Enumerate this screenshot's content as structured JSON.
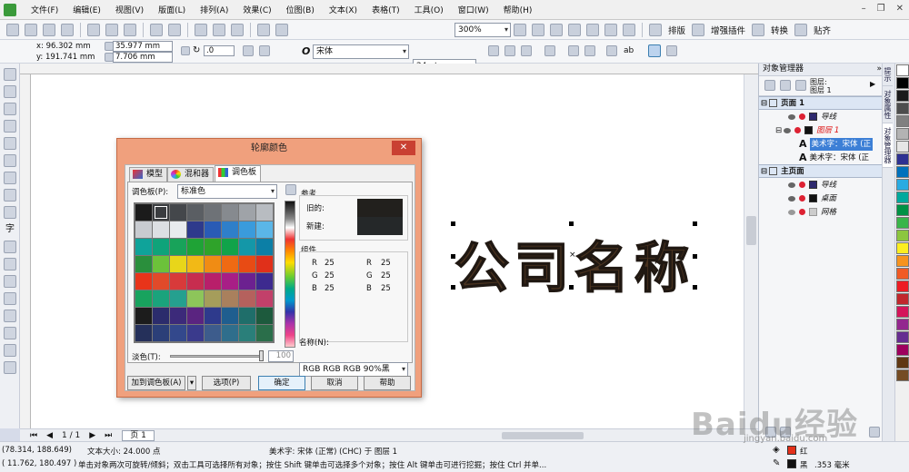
{
  "menubar": {
    "items": [
      "文件(F)",
      "编辑(E)",
      "视图(V)",
      "版面(L)",
      "排列(A)",
      "效果(C)",
      "位图(B)",
      "文本(X)",
      "表格(T)",
      "工具(O)",
      "窗口(W)",
      "帮助(H)"
    ]
  },
  "toolbar1": {
    "zoom": "300%",
    "layout_label": "排版",
    "plugin_label": "增强插件",
    "convert_label": "转换",
    "paste_label": "贴齐"
  },
  "toolbar2": {
    "x": "x: 96.302 mm",
    "y": "y: 191.741 mm",
    "w": "35.977 mm",
    "h": "7.706 mm",
    "rotation": ".0",
    "font": "宋体",
    "font_size": "24 pt",
    "ab_label": "ab"
  },
  "canvas": {
    "text": "公司名称"
  },
  "dialog": {
    "title": "轮廓颜色",
    "close": "✕",
    "tabs": [
      "模型",
      "混和器",
      "调色板"
    ],
    "palette_label": "调色板(P):",
    "palette_value": "标准色",
    "reference_label": "参考",
    "old_label": "旧的:",
    "new_label": "新建:",
    "old_color": "#22201d",
    "new_color": "#252829",
    "components_label": "组件",
    "r_label": "R",
    "g_label": "G",
    "b_label": "B",
    "r1": "25",
    "g1": "25",
    "b1": "25",
    "r2": "25",
    "g2": "25",
    "b2": "25",
    "name_label": "名称(N):",
    "name_value": "RGB RGB RGB 90%黑",
    "tint_label": "淡色(T):",
    "tint_value": "100",
    "add_palette_btn": "加到调色板(A)",
    "options_btn": "选项(P)",
    "ok_btn": "确定",
    "cancel_btn": "取消",
    "help_btn": "帮助",
    "swatches": [
      "#1b1b1b",
      "#3a3c3f",
      "#44474b",
      "#5a5e63",
      "#6e7277",
      "#868a8f",
      "#9fa3a8",
      "#b8bcc1",
      "#c8cbd0",
      "#dcdfe3",
      "#e9ebee",
      "#2e3a8c",
      "#2a5bb5",
      "#2f7fc9",
      "#3a9bdc",
      "#5ab6e8",
      "#0fa39a",
      "#0fa37a",
      "#18a35a",
      "#1fa336",
      "#2fa32a",
      "#11a34a",
      "#1497a8",
      "#0c7fa6",
      "#2a8f3c",
      "#6cc23a",
      "#e8d61a",
      "#f2b916",
      "#f08c14",
      "#ef6a14",
      "#e84b14",
      "#e0301a",
      "#e8341a",
      "#e14a2a",
      "#d83a3a",
      "#c72d4f",
      "#b81f6a",
      "#a81e86",
      "#6c2190",
      "#3d2a8f",
      "#18a35e",
      "#1aa37c",
      "#25a08f",
      "#8dc55a",
      "#a59d5b",
      "#a9805d",
      "#b5615d",
      "#c2406a",
      "#1c1c1c",
      "#2b2c6c",
      "#3c2a7a",
      "#5a2480",
      "#2e3a8c",
      "#1f5e8f",
      "#1f6e6a",
      "#1d5a3d",
      "#25305a",
      "#2b3f78",
      "#33488c",
      "#3a3a8c",
      "#3d5c8c",
      "#2f6e8c",
      "#2a7f7a",
      "#2a6e4a"
    ]
  },
  "docker": {
    "title": "对象管理器",
    "layer_header": "图层:",
    "layer_value": "图层 1",
    "page1": "页面 1",
    "guides": "导线",
    "layer1": "图层 1",
    "art1": "美术字：宋体 (正",
    "art2": "美术字：宋体 (正",
    "master": "主页面",
    "guides2": "导线",
    "desktop": "桌面",
    "grid": "网格",
    "side_tabs": [
      "提示",
      "对象属性",
      "对象管理器"
    ]
  },
  "palette_colors": [
    "#ffffff",
    "#000000",
    "#1a1a1a",
    "#4d4d4d",
    "#808080",
    "#b3b3b3",
    "#e6e6e6",
    "#2e3192",
    "#0071bc",
    "#29abe2",
    "#00a99d",
    "#009245",
    "#39b54a",
    "#8cc63f",
    "#fcee21",
    "#f7931e",
    "#f15a24",
    "#ed1c24",
    "#c1272d",
    "#d4145a",
    "#93278f",
    "#662d91",
    "#9e005d",
    "#603813",
    "#754c24"
  ],
  "pagebar": {
    "page_count": "1 / 1",
    "page_tab": "页 1"
  },
  "statusbar": {
    "coord1": "(78.314, 188.649)",
    "text_size": "文本大小: 24.000 点",
    "coord2": "( 11.762, 180.497 )",
    "hint": "单击对象两次可旋转/倾斜；双击工具可选择所有对象；按住 Shift 键单击可选择多个对象；按住 Alt 键单击可进行挖掘；按住 Ctrl 并单...",
    "object_info": "美术字: 宋体 (正常) (CHC) 于 图层 1",
    "fill_label": "红",
    "outline_label": "黑",
    "outline_width": ".353 毫米"
  },
  "watermark": {
    "brand": "Baidu经验",
    "url": "jingyan.baidu.com"
  }
}
